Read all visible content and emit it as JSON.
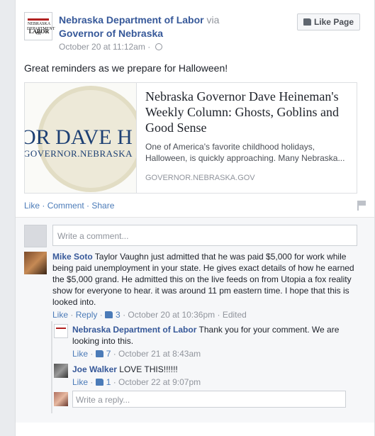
{
  "post": {
    "page_name": "Nebraska Department of Labor",
    "via": "via",
    "shared_page": "Governor of Nebraska",
    "timestamp": "October 20 at 11:12am",
    "like_page_label": "Like Page",
    "text": "Great reminders as we prepare for Halloween!",
    "logo_text_top": "NEBRASKA DEPARTMENT OF",
    "logo_text_bottom": "LABOR"
  },
  "share": {
    "image_line1": "OR DAVE H",
    "image_line2": "GOVERNOR.NEBRASKA",
    "title": "Nebraska Governor Dave Heineman's Weekly Column: Ghosts, Goblins and Good Sense",
    "description": "One of America's favorite childhood holidays, Halloween, is quickly approaching. Many Nebraska...",
    "domain": "GOVERNOR.NEBRASKA.GOV"
  },
  "actions": {
    "like": "Like",
    "comment": "Comment",
    "share": "Share",
    "sep": " · "
  },
  "write_comment_placeholder": "Write a comment...",
  "comments": [
    {
      "name": "Mike Soto",
      "text": "Taylor Vaughn just admitted that he was paid $5,000 for work while being paid unemployment in your state. He gives exact details of how he earned the $5,000 grand. He admitted this on the live feeds on from Utopia a fox reality show for everyone to hear. it was around 11 pm eastern time. I hope that this is looked into.",
      "like": "Like",
      "reply": "Reply",
      "likes": "3",
      "time": "October 20 at 10:36pm",
      "edited": "Edited"
    }
  ],
  "replies": [
    {
      "name": "Nebraska Department of Labor",
      "text": "Thank you for your comment. We are looking into this.",
      "like": "Like",
      "likes": "7",
      "time": "October 21 at 8:43am"
    },
    {
      "name": "Joe Walker",
      "text": "LOVE THIS!!!!!!",
      "like": "Like",
      "likes": "1",
      "time": "October 22 at 9:07pm"
    }
  ],
  "write_reply_placeholder": "Write a reply..."
}
